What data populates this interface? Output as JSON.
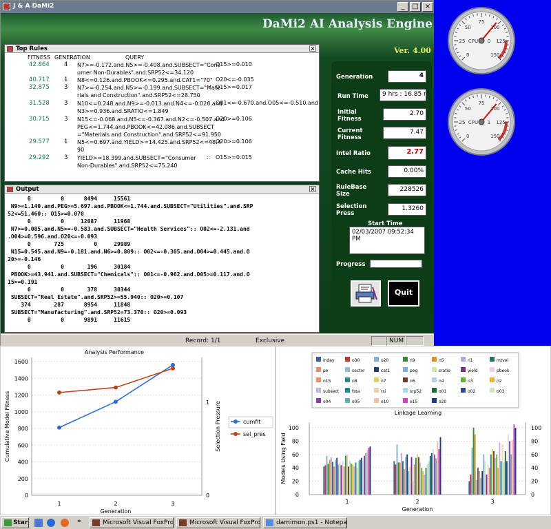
{
  "window": {
    "title": "J & A DaMi2"
  },
  "engine": {
    "title": "DaMi2 AI Analysis Engine",
    "version": "Ver. 4.00"
  },
  "top_rules": {
    "title": "Top Rules",
    "headers": {
      "fitness": "FITNESS",
      "generation": "GENERATION",
      "query": "QUERY"
    },
    "rows": [
      {
        "fitness": "42.864",
        "gen": "4",
        "q1": "N7>=-0.172.and.N5>=-0.408.and.SUBSECT=\"Cons",
        "q2": "umer Non-Durables\".and.SRP52<=34.120",
        "result": "O15>=0.010"
      },
      {
        "fitness": "40.717",
        "gen": "1",
        "q1": "N8<=0.126.and.PBOOK<=0.295.and.CAT1=\"70\"",
        "q2": "",
        "result": "O20<=-0.035"
      },
      {
        "fitness": "32.875",
        "gen": "3",
        "q1": "N7>=-0.254.and.N5>=-0.199.and.SUBSECT=\"Mate",
        "q2": "rials and Construction\".and.SRP52<=28.750",
        "result": "O15>=0.017"
      },
      {
        "fitness": "31.528",
        "gen": "3",
        "q1": "N10<=0.248.and.N9>=-0.013.and.N4<=-0.026.and",
        "q2": "N3>=0.936.and.SRATIO<=1.849",
        "result": "O01<=-0.670.and.O05<=-0.510.and.O10>"
      },
      {
        "fitness": "30.715",
        "gen": "3",
        "q1": "N15<=-0.068.and.N5<=-0.367.and.N2<=-0.507.and",
        "q2": "PEG<=1.744.and.PBOOK<=42.086.and.SUBSECT",
        "q3": "=\"Materials and Construction\".and.SRP52<=91.950",
        "result": "O20>=0.106"
      },
      {
        "fitness": "29.577",
        "gen": "1",
        "q1": "N5<=0.697.and.YIELD>=14.425.and.SRP52<=48.4",
        "q2": "90",
        "result": "O20>=0.106"
      },
      {
        "fitness": "29.292",
        "gen": "3",
        "q1": "YIELD>=18.399.and.SUBSECT=\"Consumer",
        "q2": "Non-Durables\".and.SRP52<=75.240",
        "result": "O15>=0.015"
      }
    ],
    "sep": "::"
  },
  "output": {
    "title": "Output",
    "lines": [
      "      0         0      8494     15561",
      " N9>=1.140.and.PEG>=5.697.and.PBOOK<=1.744.and.SUBSECT=\"Utilities\".and.SRP",
      "52<=51.460:: O15>=0.070",
      "      0         0     12087     11968",
      " N7>=0.085.and.N5>=-0.583.and.SUBSECT=\"Health Services\":: O02<=-2.131.and",
      ".O04>=0.596.and.O20<=-0.093",
      "      0       725         0     29989",
      " N15=0.545.and.N9=-0.181.and.N6>=0.809:: O02<=-0.305.and.O04>=0.445.and.O",
      "20>=-0.146",
      "      0         0       196     30184",
      " PBOOK>=43.941.and.SUBSECT=\"Chemicals\":: O01<=-0.962.and.O05>=0.117.and.O",
      "15>=0.191",
      "      0         0       378     30344",
      " SUBSECT=\"Real Estate\".and.SRP52>=55.940:: O20>=0.107",
      "    374       287      8954     11848",
      " SUBSECT=\"Manufacturing\".and.SRP52=73.370:: O20>=0.093",
      "      0         0      9891     11615"
    ]
  },
  "metrics": {
    "generation": {
      "label": "Generation",
      "value": "4"
    },
    "run_time": {
      "label": "Run Time",
      "value": "9 hrs : 16.85 r"
    },
    "initial_fitness": {
      "label": "Initial Fitness",
      "value": "2.70"
    },
    "current_fitness": {
      "label": "Current Fitness",
      "value": "7.47"
    },
    "intel_ratio": {
      "label": "Intel Ratio",
      "value": "2.77"
    },
    "cache_hits": {
      "label": "Cache Hits",
      "value": "0.00%"
    },
    "rulebase_size": {
      "label": "RuleBase Size",
      "value": "228526"
    },
    "selection_press": {
      "label": "Selection Press",
      "value": "1.3260"
    },
    "start_time": {
      "label": "Start Time",
      "value": "02/03/2007 09:52:34 PM"
    },
    "progress": {
      "label": "Progress",
      "value": 0
    },
    "quit_label": "Quit",
    "print_icon": "printer-icon"
  },
  "status": {
    "record": "Record: 1/1",
    "mode": "Exclusive",
    "num": "NUM"
  },
  "gauges": [
    {
      "label": "CPU",
      "value": "0",
      "ticks": [
        "0",
        "25",
        "50",
        "75",
        "100",
        "125",
        "150"
      ],
      "needle": 97
    },
    {
      "label": "CPU",
      "value": "1",
      "ticks": [
        "0",
        "25",
        "50",
        "75",
        "100",
        "125",
        "150"
      ],
      "needle": 97
    }
  ],
  "analysis": {
    "chart_data": {
      "type": "line",
      "title": "Analysis Performance",
      "xlabel": "Generation",
      "ylabel": "Cumulative Model Fitness",
      "y2label": "Selection Pressure",
      "categories": [
        "1",
        "2",
        "3"
      ],
      "ylim": [
        0,
        1600
      ],
      "yticks": [
        "0",
        "200",
        "400",
        "600",
        "800",
        "1000",
        "1200",
        "1400",
        "1600"
      ],
      "y2ticks": [
        "0",
        "1"
      ],
      "series": [
        {
          "name": "cumfit",
          "values": [
            810,
            1120,
            1560
          ],
          "color": "#2f6fd6"
        },
        {
          "name": "sel_pres",
          "values": [
            1230,
            1290,
            1520
          ],
          "color": "#c0441a"
        }
      ]
    }
  },
  "linkage": {
    "chart_data": {
      "type": "bar",
      "title": "Linkage Learning",
      "xlabel": "Generation",
      "ylabel": "Models Using Field",
      "categories": [
        "1",
        "2",
        "3"
      ],
      "ylim": [
        0,
        100
      ],
      "yticks": [
        "0",
        "20",
        "40",
        "60",
        "80",
        "100"
      ],
      "legend": [
        {
          "name": "inday",
          "color": "#3a5fa8"
        },
        {
          "name": "o30",
          "color": "#c0392b"
        },
        {
          "name": "o20",
          "color": "#7db3d8"
        },
        {
          "name": "n9",
          "color": "#3a8a3a"
        },
        {
          "name": "n5",
          "color": "#e0902a"
        },
        {
          "name": "n1",
          "color": "#b8a8e0"
        },
        {
          "name": "mtvol",
          "color": "#2c6e6e"
        },
        {
          "name": "pe",
          "color": "#e88a70"
        },
        {
          "name": "sector",
          "color": "#98b8d8"
        },
        {
          "name": "cat1",
          "color": "#1f3f6f"
        },
        {
          "name": "peg",
          "color": "#7bb0e8"
        },
        {
          "name": "sratio",
          "color": "#d0e8a8"
        },
        {
          "name": "yield",
          "color": "#8a2a8a"
        },
        {
          "name": "pbook",
          "color": "#e8d0e8"
        },
        {
          "name": "n15",
          "color": "#e89060"
        },
        {
          "name": "n8",
          "color": "#2a8a8a"
        },
        {
          "name": "n7",
          "color": "#e0d060"
        },
        {
          "name": "n6",
          "color": "#7a3a2a"
        },
        {
          "name": "n4",
          "color": "#b0d0e8"
        },
        {
          "name": "n3",
          "color": "#6ab030"
        },
        {
          "name": "n2",
          "color": "#f0b030"
        },
        {
          "name": "subsect",
          "color": "#c8b0e0"
        },
        {
          "name": "fsta",
          "color": "#1a9090"
        },
        {
          "name": "rsi",
          "color": "#f0d0a0"
        },
        {
          "name": "srp52",
          "color": "#a0e0e0"
        },
        {
          "name": "o01",
          "color": "#1a6a3a"
        },
        {
          "name": "o02",
          "color": "#2a4ab0"
        },
        {
          "name": "o03",
          "color": "#d0e8c0"
        },
        {
          "name": "o04",
          "color": "#8a3ab0"
        },
        {
          "name": "o05",
          "color": "#6ab0b0"
        },
        {
          "name": "o10",
          "color": "#f0c0a0"
        },
        {
          "name": "o15",
          "color": "#d040c0"
        },
        {
          "name": "o20",
          "color": "#1a3a8a"
        }
      ],
      "groups": [
        [
          42,
          44,
          58,
          46,
          52,
          56,
          49,
          42,
          52,
          55,
          45,
          48,
          44,
          50,
          42,
          58,
          60,
          42,
          50,
          46,
          45,
          42,
          48,
          40,
          50,
          52,
          55,
          50,
          58,
          62,
          66,
          70,
          72
        ],
        [
          50,
          45,
          75,
          48,
          48,
          62,
          50,
          38,
          56,
          60,
          35,
          42,
          56,
          20,
          45,
          55,
          60,
          56,
          48,
          40,
          35,
          30,
          40,
          45,
          50,
          58,
          62,
          68,
          60,
          54,
          80,
          68,
          86
        ],
        [
          20,
          30,
          70,
          100,
          90,
          22,
          40,
          35,
          25,
          35,
          60,
          50,
          30,
          45,
          40,
          60,
          68,
          65,
          55,
          60,
          40,
          78,
          50,
          75,
          48,
          65,
          50,
          90,
          80,
          60,
          82,
          105,
          100
        ]
      ]
    }
  },
  "taskbar": {
    "start": "Start",
    "items": [
      "Microsoft Visual FoxPro",
      "Microsoft Visual FoxPro",
      "damimon.ps1 - Notepad"
    ],
    "chevron": "»"
  }
}
